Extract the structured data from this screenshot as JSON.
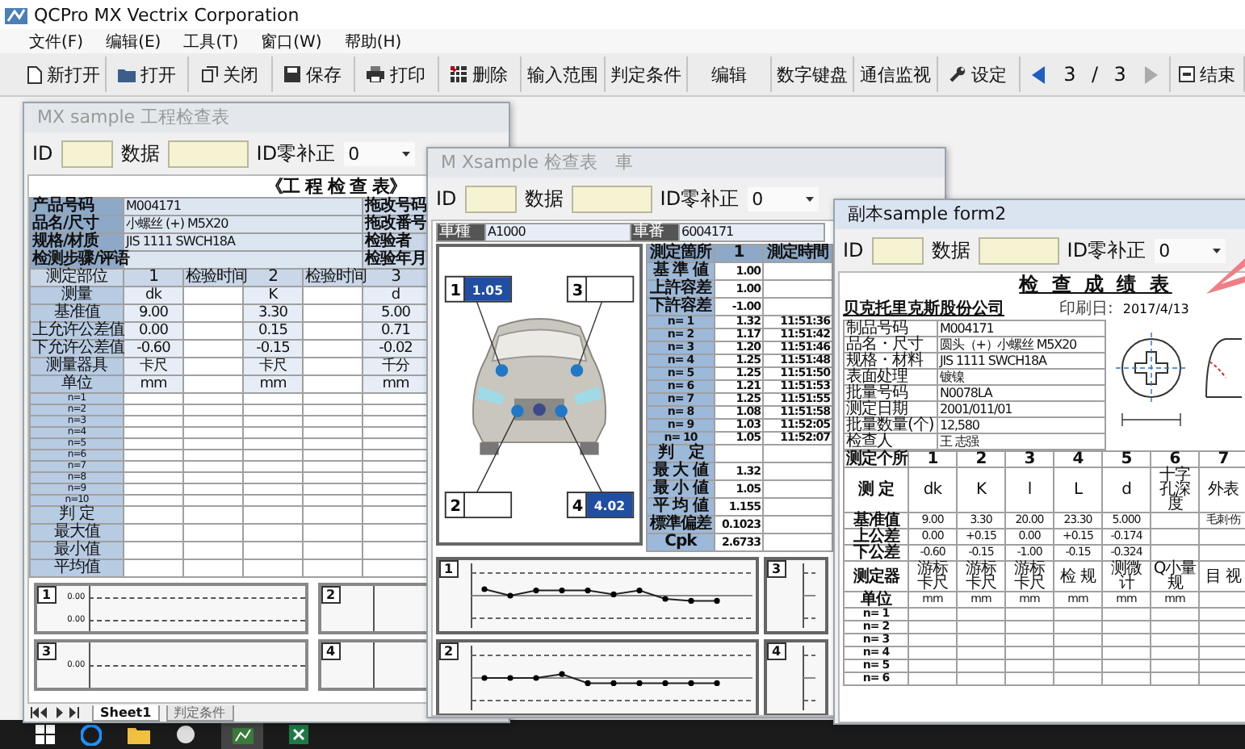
{
  "app": {
    "title": "QCPro MX  Vectrix Corporation"
  },
  "menu": [
    {
      "label": "文件(F)"
    },
    {
      "label": "编辑(E)"
    },
    {
      "label": "工具(T)"
    },
    {
      "label": "窗口(W)"
    },
    {
      "label": "帮助(H)"
    }
  ],
  "toolbar": [
    {
      "label": "新打开"
    },
    {
      "label": "打开"
    },
    {
      "label": "关闭"
    },
    {
      "label": "保存"
    },
    {
      "label": "打印"
    },
    {
      "label": "删除"
    },
    {
      "label": "输入范围"
    },
    {
      "label": "判定条件"
    },
    {
      "label": "编辑"
    },
    {
      "label": "数字键盘"
    },
    {
      "label": "通信监视"
    },
    {
      "label": "设定"
    }
  ],
  "pager": {
    "current": "3",
    "separator": "/",
    "total": "3"
  },
  "end_button": {
    "label": "结束"
  },
  "windows": [
    {
      "kind": "inspection",
      "active": false,
      "title": "MX sample 工程检查表",
      "id_label": "ID",
      "data_label": "数据",
      "zero_label": "ID零补正",
      "zero_value": "0",
      "sheet": {
        "title": "《工 程 检 查 表》",
        "info": [
          {
            "label": "产品号码",
            "value": "M004171",
            "side": "拖改号码"
          },
          {
            "label": "品名/尺寸",
            "value": "小螺丝 (+) M5X20",
            "side": "拖改番号"
          },
          {
            "label": "规格/材质",
            "value": "JIS 1111 SWCH18A",
            "side": "检验者"
          },
          {
            "label": "检测步骤/评语",
            "side": "检验年月"
          }
        ],
        "header": [
          "测定部位",
          "1",
          "检验时间",
          "2",
          "检验时间",
          "3"
        ],
        "params": [
          {
            "label": "测量",
            "values": [
              "dk",
              "K",
              "d"
            ]
          },
          {
            "label": "基准值",
            "values": [
              "9.00",
              "3.30",
              "5.00"
            ]
          },
          {
            "label": "上允许公差值",
            "values": [
              "0.00",
              "0.15",
              "0.71"
            ]
          },
          {
            "label": "下允许公差值",
            "values": [
              "-0.60",
              "-0.15",
              "-0.02"
            ]
          },
          {
            "label": "测量器具",
            "values": [
              "卡尺",
              "卡尺",
              "千分"
            ]
          },
          {
            "label": "单位",
            "values": [
              "mm",
              "mm",
              "mm"
            ]
          }
        ],
        "samples": [
          "n=1",
          "n=2",
          "n=3",
          "n=4",
          "n=5",
          "n=6",
          "n=7",
          "n=8",
          "n=9",
          "n=10"
        ],
        "stats": [
          "判 定",
          "最大值",
          "最小值",
          "平均值"
        ],
        "charts": [
          {
            "number": "1",
            "ticks": [
              "0.00",
              "0.00"
            ]
          },
          {
            "number": "2"
          },
          {
            "number": "3",
            "ticks": [
              "0.00"
            ]
          },
          {
            "number": "4"
          }
        ]
      },
      "sheet_tabs": [
        {
          "label": "Sheet1",
          "selected": true
        },
        {
          "label": "判定条件",
          "selected": false
        }
      ]
    },
    {
      "kind": "car",
      "active": false,
      "title": "M Xsample 检查表　車",
      "id_label": "ID",
      "data_label": "数据",
      "zero_label": "ID零补正",
      "zero_value": "0",
      "sheet": {
        "header": [
          "車種",
          "A1000",
          "車番",
          "6004171"
        ],
        "points": [
          {
            "number": "1",
            "value": "1.05",
            "highlighted": true
          },
          {
            "number": "2",
            "highlighted": false
          },
          {
            "number": "3",
            "highlighted": false
          },
          {
            "number": "4",
            "value": "4.02",
            "highlighted": true
          }
        ],
        "table_header": [
          "測定箇所",
          "1",
          "測定時間"
        ],
        "limits": [
          {
            "label": "基 準 値",
            "value": "1.00"
          },
          {
            "label": "上許容差",
            "value": "1.00"
          },
          {
            "label": "下許容差",
            "value": "-1.00"
          }
        ],
        "samples": [
          {
            "label": "n= 1",
            "value": "1.32",
            "time": "11:51:36"
          },
          {
            "label": "n= 2",
            "value": "1.17",
            "time": "11:51:42"
          },
          {
            "label": "n= 3",
            "value": "1.20",
            "time": "11:51:46"
          },
          {
            "label": "n= 4",
            "value": "1.25",
            "time": "11:51:48"
          },
          {
            "label": "n= 5",
            "value": "1.25",
            "time": "11:51:50"
          },
          {
            "label": "n= 6",
            "value": "1.21",
            "time": "11:51:53"
          },
          {
            "label": "n= 7",
            "value": "1.25",
            "time": "11:51:55"
          },
          {
            "label": "n= 8",
            "value": "1.08",
            "time": "11:51:58"
          },
          {
            "label": "n= 9",
            "value": "1.03",
            "time": "11:52:05"
          },
          {
            "label": "n= 10",
            "value": "1.05",
            "time": "11:52:07"
          }
        ],
        "judgement": "判　定",
        "stats": [
          {
            "label": "最 大 値",
            "value": "1.32"
          },
          {
            "label": "最 小 値",
            "value": "1.05"
          },
          {
            "label": "平 均 値",
            "value": "1.155"
          },
          {
            "label": "標準偏差",
            "value": "0.1023"
          },
          {
            "label": "Cpk",
            "value": "2.6733"
          }
        ],
        "charts": [
          {
            "number": "1"
          },
          {
            "number": "3"
          },
          {
            "number": "2"
          },
          {
            "number": "4"
          }
        ]
      }
    },
    {
      "kind": "report",
      "active": true,
      "title": "副本sample form2",
      "id_label": "ID",
      "data_label": "数据",
      "zero_label": "ID零补正",
      "zero_value": "0",
      "sheet": {
        "title": "检 查 成 绩 表",
        "company": "贝克托里克斯股份公司",
        "date_label": "印刷日:",
        "date": "2017/4/13",
        "info": [
          {
            "label": "制品号码",
            "value": "M004171"
          },
          {
            "label": "品名・尺寸",
            "value": "圆头（+）小螺丝 M5X20"
          },
          {
            "label": "规格・材料",
            "value": "JIS 1111 SWCH18A"
          },
          {
            "label": "表面处理",
            "value": "镀镍"
          },
          {
            "label": "批量号码",
            "value": "N0078LA"
          },
          {
            "label": "测定日期",
            "value": "2001/011/01"
          },
          {
            "label": "批量数量(个)",
            "value": "12,580"
          },
          {
            "label": "检查人",
            "value": "王 志强"
          }
        ],
        "columns_label": "测定个所",
        "columns": [
          "1",
          "2",
          "3",
          "4",
          "5",
          "6",
          "7"
        ],
        "rows": [
          {
            "kind": "text",
            "label": "测 定",
            "values": [
              {
                "text": "dk"
              },
              {
                "text": "K"
              },
              {
                "text": "l"
              },
              {
                "text": "L"
              },
              {
                "text": "d"
              },
              {
                "text": "十字孔深度"
              },
              {
                "text": "外表"
              }
            ]
          },
          {
            "kind": "number",
            "label": "基准值",
            "values": [
              {
                "text": "9.00"
              },
              {
                "text": "3.30"
              },
              {
                "text": "20.00"
              },
              {
                "text": "23.30"
              },
              {
                "text": "5.000"
              },
              {
                "blank": true
              },
              {
                "text": "毛刺·伤"
              }
            ]
          },
          {
            "kind": "number",
            "label": "上公差",
            "values": [
              {
                "text": "0.00"
              },
              {
                "text": "+0.15"
              },
              {
                "text": "0.00"
              },
              {
                "text": "+0.15"
              },
              {
                "text": "-0.174"
              }
            ]
          },
          {
            "kind": "number",
            "label": "下公差",
            "values": [
              {
                "text": "-0.60"
              },
              {
                "text": "-0.15"
              },
              {
                "text": "-1.00"
              },
              {
                "text": "-0.15"
              },
              {
                "text": "-0.324"
              }
            ]
          },
          {
            "kind": "text",
            "label": "测定器",
            "values": [
              {
                "text": "游标卡尺"
              },
              {
                "text": "游标卡尺"
              },
              {
                "text": "游标卡尺"
              },
              {
                "text": "检 规"
              },
              {
                "text": "测微计"
              },
              {
                "text": "Q小量规"
              },
              {
                "text": "目 视"
              }
            ]
          },
          {
            "kind": "number",
            "label": "单位",
            "values": [
              {
                "text": "mm"
              },
              {
                "text": "mm"
              },
              {
                "text": "mm"
              },
              {
                "text": "mm"
              },
              {
                "text": "mm"
              },
              {
                "text": "mm"
              }
            ]
          }
        ],
        "samples": [
          "n= 1",
          "n= 2",
          "n= 3",
          "n= 4",
          "n= 5",
          "n= 6"
        ]
      }
    }
  ]
}
